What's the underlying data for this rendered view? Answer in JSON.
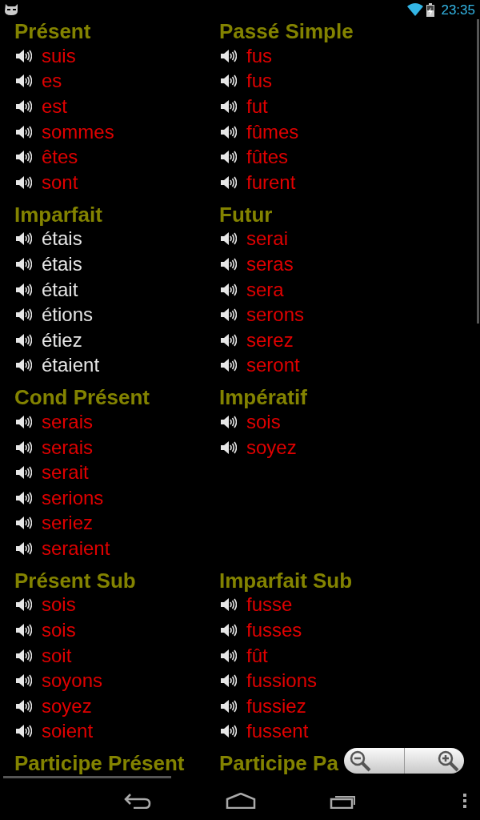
{
  "status_bar": {
    "time": "23:35"
  },
  "sections": [
    {
      "title": "Présent",
      "forms": [
        {
          "text": "suis",
          "irregular": true
        },
        {
          "text": "es",
          "irregular": true
        },
        {
          "text": "est",
          "irregular": true
        },
        {
          "text": "sommes",
          "irregular": true
        },
        {
          "text": "êtes",
          "irregular": true
        },
        {
          "text": "sont",
          "irregular": true
        }
      ]
    },
    {
      "title": "Passé Simple",
      "forms": [
        {
          "text": "fus",
          "irregular": true
        },
        {
          "text": "fus",
          "irregular": true
        },
        {
          "text": "fut",
          "irregular": true
        },
        {
          "text": "fûmes",
          "irregular": true
        },
        {
          "text": "fûtes",
          "irregular": true
        },
        {
          "text": "furent",
          "irregular": true
        }
      ]
    },
    {
      "title": "Imparfait",
      "forms": [
        {
          "text": "étais",
          "irregular": false
        },
        {
          "text": "étais",
          "irregular": false
        },
        {
          "text": "était",
          "irregular": false
        },
        {
          "text": "étions",
          "irregular": false
        },
        {
          "text": "étiez",
          "irregular": false
        },
        {
          "text": "étaient",
          "irregular": false
        }
      ]
    },
    {
      "title": "Futur",
      "forms": [
        {
          "text": "serai",
          "irregular": true
        },
        {
          "text": "seras",
          "irregular": true
        },
        {
          "text": "sera",
          "irregular": true
        },
        {
          "text": "serons",
          "irregular": true
        },
        {
          "text": "serez",
          "irregular": true
        },
        {
          "text": "seront",
          "irregular": true
        }
      ]
    },
    {
      "title": "Cond Présent",
      "forms": [
        {
          "text": "serais",
          "irregular": true
        },
        {
          "text": "serais",
          "irregular": true
        },
        {
          "text": "serait",
          "irregular": true
        },
        {
          "text": "serions",
          "irregular": true
        },
        {
          "text": "seriez",
          "irregular": true
        },
        {
          "text": "seraient",
          "irregular": true
        }
      ]
    },
    {
      "title": "Impératif",
      "forms": [
        {
          "text": "sois",
          "irregular": true
        },
        {
          "text": "soyez",
          "irregular": true
        }
      ]
    },
    {
      "title": "Présent Sub",
      "forms": [
        {
          "text": "sois",
          "irregular": true
        },
        {
          "text": "sois",
          "irregular": true
        },
        {
          "text": "soit",
          "irregular": true
        },
        {
          "text": "soyons",
          "irregular": true
        },
        {
          "text": "soyez",
          "irregular": true
        },
        {
          "text": "soient",
          "irregular": true
        }
      ]
    },
    {
      "title": "Imparfait Sub",
      "forms": [
        {
          "text": "fusse",
          "irregular": true
        },
        {
          "text": "fusses",
          "irregular": true
        },
        {
          "text": "fût",
          "irregular": true
        },
        {
          "text": "fussions",
          "irregular": true
        },
        {
          "text": "fussiez",
          "irregular": true
        },
        {
          "text": "fussent",
          "irregular": true
        }
      ]
    },
    {
      "title": "Participe Présent"
    },
    {
      "title": "Participe Pa"
    }
  ]
}
